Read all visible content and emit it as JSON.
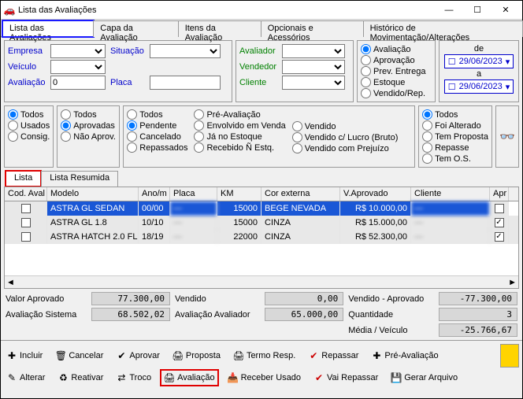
{
  "window": {
    "title": "Lista das Avaliações"
  },
  "tabs": [
    "Lista das Avaliações",
    "Capa da Avaliação",
    "Itens da Avaliação",
    "Opcionais e Acessórios",
    "Histórico de Movimentação/Alterações"
  ],
  "filters": {
    "empresa": "Empresa",
    "situacao": "Situação",
    "avaliador": "Avaliador",
    "veiculo": "Veículo",
    "vendedor": "Vendedor",
    "avaliacao": "Avaliação",
    "avaliacao_val": "0",
    "placa": "Placa",
    "cliente": "Cliente"
  },
  "type_radios": {
    "avaliacao": "Avaliação",
    "aprovacao": "Aprovação",
    "prev": "Prev. Entrega",
    "estoque": "Estoque",
    "vendrep": "Vendido/Rep."
  },
  "dates": {
    "de": "de",
    "de_val": "29/06/2023",
    "a": "a",
    "a_val": "29/06/2023"
  },
  "rg1": {
    "todos": "Todos",
    "usados": "Usados",
    "consig": "Consig."
  },
  "rg2": {
    "todos": "Todos",
    "aprovadas": "Aprovadas",
    "naoaprov": "Não Aprov."
  },
  "rg3": {
    "todos": "Todos",
    "pendente": "Pendente",
    "cancelado": "Cancelado",
    "repassados": "Repassados",
    "preav": "Pré-Avaliação",
    "envvenda": "Envolvido em Venda",
    "jaestoque": "Já no Estoque",
    "recnesq": "Recebido Ñ Estq.",
    "vendido": "Vendido",
    "vendlucro": "Vendido c/ Lucro (Bruto)",
    "vendprej": "Vendido com Prejuízo"
  },
  "rg4": {
    "todos": "Todos",
    "foialt": "Foi Alterado",
    "temprop": "Tem Proposta",
    "repasse": "Repasse",
    "temos": "Tem O.S."
  },
  "subtabs": {
    "lista": "Lista",
    "resumida": "Lista Resumida"
  },
  "grid": {
    "headers": [
      "Cod. Aval",
      "Modelo",
      "Ano/m",
      "Placa",
      "KM",
      "Cor externa",
      "V.Aprovado",
      "Cliente",
      "Apr"
    ],
    "rows": [
      {
        "modelo": "ASTRA GL SEDAN",
        "ano": "00/00",
        "placa": "—",
        "km": "15000",
        "cor": "BEGE NEVADA",
        "vap": "R$ 10.000,00",
        "cli": "—",
        "apr": true
      },
      {
        "modelo": "ASTRA GL 1.8",
        "ano": "10/10",
        "placa": "—",
        "km": "15000",
        "cor": "CINZA",
        "vap": "R$ 15.000,00",
        "cli": "—",
        "apr": true
      },
      {
        "modelo": "ASTRA HATCH  2.0 FL",
        "ano": "18/19",
        "placa": "—",
        "km": "22000",
        "cor": "CINZA",
        "vap": "R$ 52.300,00",
        "cli": "—",
        "apr": true
      }
    ]
  },
  "totals": {
    "vap_l": "Valor Aprovado",
    "vap_v": "77.300,00",
    "vend_l": "Vendido",
    "vend_v": "0,00",
    "va_l": "Vendido - Aprovado",
    "va_v": "-77.300,00",
    "avs_l": "Avaliação Sistema",
    "avs_v": "68.502,02",
    "ava_l": "Avaliação Avaliador",
    "ava_v": "65.000,00",
    "qtd_l": "Quantidade",
    "qtd_v": "3",
    "med_l": "Média / Veículo",
    "med_v": "-25.766,67"
  },
  "toolbar": {
    "incluir": "Incluir",
    "cancelar": "Cancelar",
    "aprovar": "Aprovar",
    "proposta": "Proposta",
    "termo": "Termo Resp.",
    "repassar": "Repassar",
    "preav": "Pré-Avaliação",
    "alterar": "Alterar",
    "reativar": "Reativar",
    "troco": "Troco",
    "avaliacao": "Avaliação",
    "recusado": "Receber Usado",
    "vairep": "Vai Repassar",
    "gerar": "Gerar Arquivo"
  }
}
